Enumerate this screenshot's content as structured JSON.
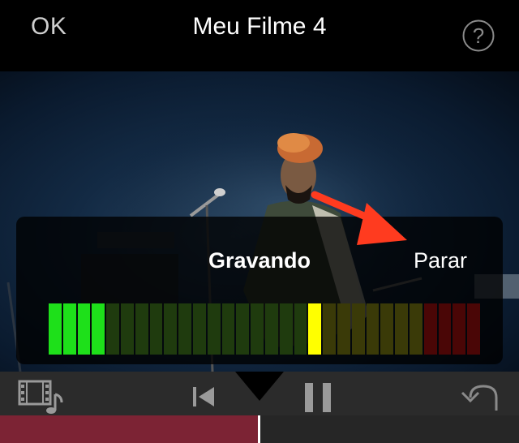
{
  "header": {
    "ok_label": "OK",
    "title": "Meu Filme 4",
    "help_icon": "question-circle-icon"
  },
  "recording": {
    "status_label": "Gravando",
    "stop_label": "Parar",
    "annotation_arrow_color": "#ff3b1f"
  },
  "level_meter": {
    "segments": 30,
    "active_segments": [
      "#22e61e",
      "#22e61e",
      "#22e61e",
      "#22e61e",
      "#22e61e"
    ],
    "colors": {
      "green_on": "#1ee01a",
      "green_off": "#1f3b0e",
      "yellow_on": "#ffff00",
      "yellow_off": "#3a3a08",
      "red_off": "#4a0606"
    },
    "lit_green_count": 4,
    "peak_index": 18
  },
  "toolbar": {
    "media_icon": "film-music-icon",
    "rewind_icon": "skip-to-start-icon",
    "pause_icon": "pause-icon",
    "undo_icon": "undo-icon"
  },
  "timeline": {
    "audio_clip_color": "#7c2334",
    "playhead_color": "#ffffff"
  }
}
